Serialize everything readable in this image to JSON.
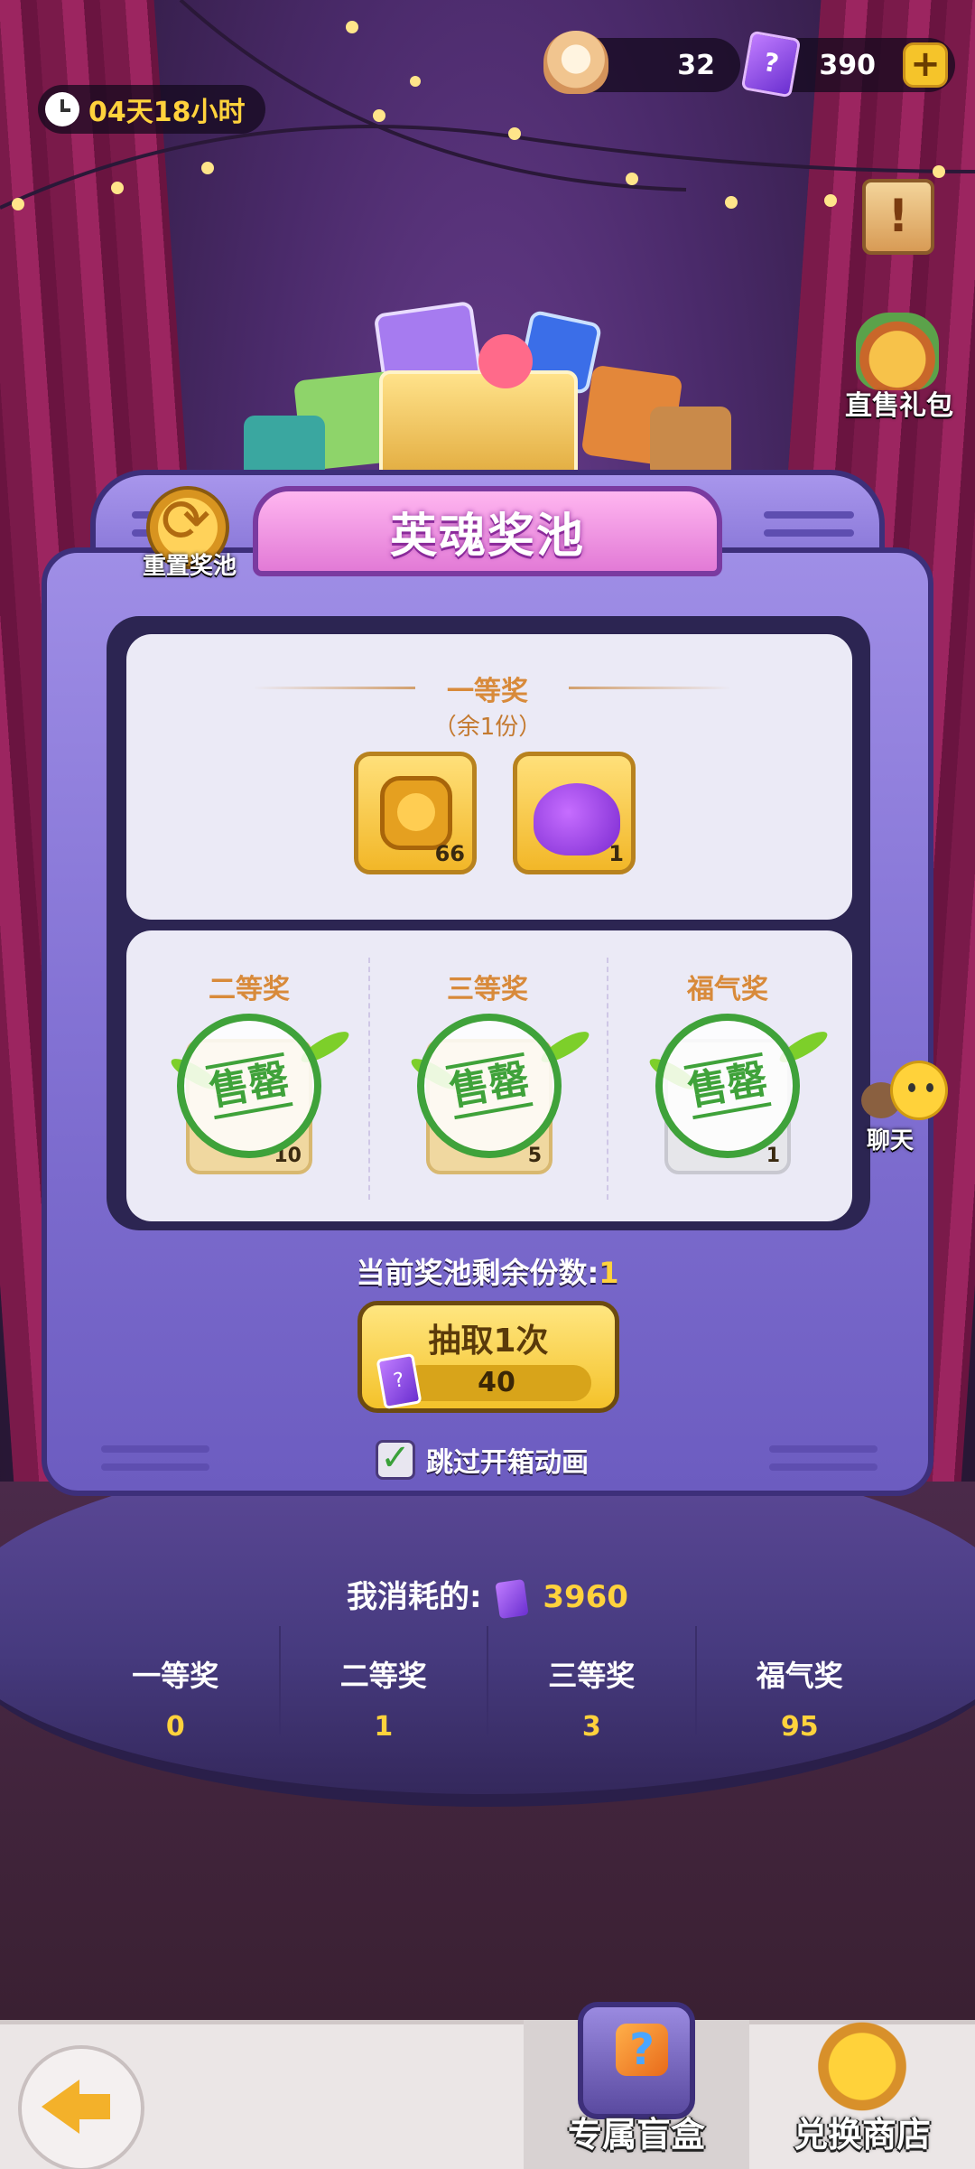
{
  "header": {
    "timer": "04天18小时",
    "shell_count": "32",
    "ticket_count": "390"
  },
  "side": {
    "gift_pack": "直售礼包",
    "chat": "聊天"
  },
  "pool": {
    "title": "英魂奖池",
    "reset_label": "重置奖池",
    "first": {
      "title": "一等奖",
      "remaining": "（余1份）",
      "items": [
        {
          "icon": "hero-coin-icon",
          "count": "66"
        },
        {
          "icon": "purple-bag-icon",
          "count": "1"
        }
      ]
    },
    "tiers": [
      {
        "title": "二等奖",
        "status": "售罄",
        "count": "10"
      },
      {
        "title": "三等奖",
        "status": "售罄",
        "count": "5"
      },
      {
        "title": "福气奖",
        "status": "售罄",
        "count": "1"
      }
    ],
    "remaining_label": "当前奖池剩余份数:",
    "remaining_value": "1"
  },
  "draw": {
    "label": "抽取1次",
    "cost": "40",
    "skip_label": "跳过开箱动画",
    "skip_checked": true
  },
  "stats": {
    "consumed_label": "我消耗的:",
    "consumed_value": "3960",
    "items": [
      {
        "label": "一等奖",
        "value": "0"
      },
      {
        "label": "二等奖",
        "value": "1"
      },
      {
        "label": "三等奖",
        "value": "3"
      },
      {
        "label": "福气奖",
        "value": "95"
      }
    ]
  },
  "nav": {
    "tabs": [
      {
        "label": "专属盲盒",
        "active": true
      },
      {
        "label": "兑换商店",
        "active": false
      }
    ]
  },
  "colors": {
    "accent_gold": "#ffd23c",
    "machine_purple": "#8372d4",
    "soldout_green": "#3fa23a",
    "title_pink": "#e27ad6"
  }
}
